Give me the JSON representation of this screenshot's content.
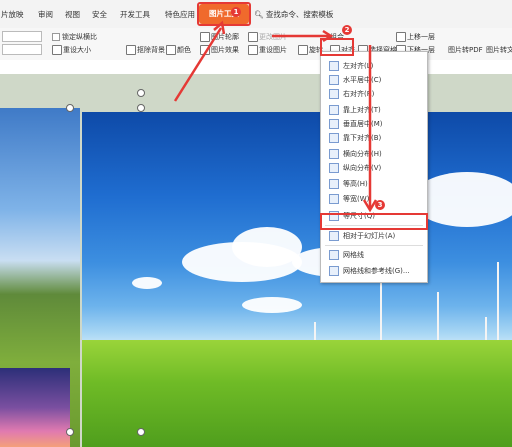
{
  "tabs": {
    "t1": "片放映",
    "t2": "审阅",
    "t3": "视图",
    "t4": "安全",
    "t5": "开发工具",
    "t6": "特色应用",
    "active": "图片工具",
    "search": "查找命令、搜索模板"
  },
  "ribbon": {
    "lock_ratio": "锁定纵横比",
    "reset_size": "重设大小",
    "crop_bg": "抠除背景",
    "color": "颜色",
    "pic_effect": "图片效果",
    "outline": "图片轮廓",
    "change_pic": "更改图片",
    "reset_pic": "重设图片",
    "rotate": "旋转",
    "combine": "组合",
    "align": "对齐",
    "select_pane": "选择窗格",
    "bring_forward": "上移一层",
    "send_backward": "下移一层",
    "to_pdf": "图片转PDF",
    "to_text": "图片转文"
  },
  "menu": {
    "left": "左对齐(L)",
    "center_h": "水平居中(C)",
    "right": "右对齐(R)",
    "top": "靠上对齐(T)",
    "middle_v": "垂直居中(M)",
    "bottom": "靠下对齐(B)",
    "dist_h": "横向分布(H)",
    "dist_v": "纵向分布(V)",
    "same_height": "等高(H)",
    "same_width": "等宽(W)",
    "same_size": "等尺寸(Q)",
    "relative_slide": "相对于幻灯片(A)",
    "grid": "网格线",
    "grid_guides": "网格线和参考线(G)..."
  },
  "badges": {
    "b1": "1",
    "b2": "2",
    "b3": "3"
  },
  "colors": {
    "accent": "#f06a2c",
    "annotation": "#e53935"
  }
}
